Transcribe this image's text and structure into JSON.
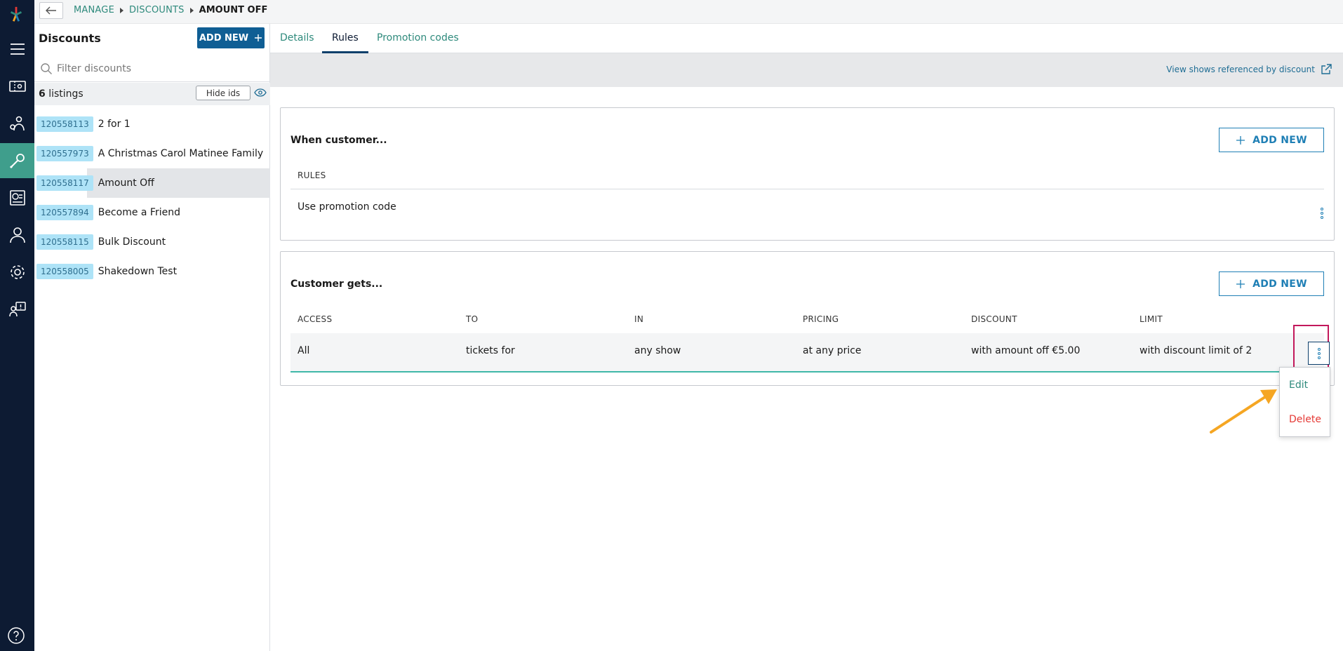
{
  "colors": {
    "rail_bg": "#0d1b33",
    "active_nav": "#3f9e8c",
    "link_teal": "#2e8a7c",
    "primary_blue": "#0f5e94",
    "badge_bg": "#aee3f7",
    "delete_red": "#e53935",
    "highlight_magenta": "#c2185b",
    "arrow_orange": "#f5a623"
  },
  "rail": {
    "icons": [
      "logo",
      "menu-icon",
      "ticket-icon",
      "users-icon",
      "tools-icon",
      "reports-icon",
      "person-icon",
      "gear-icon",
      "support-icon",
      "help-icon"
    ],
    "active": "tools-icon"
  },
  "breadcrumb": {
    "items": [
      "MANAGE",
      "DISCOUNTS"
    ],
    "current": "AMOUNT OFF"
  },
  "sidebar": {
    "title": "Discounts",
    "add_new_label": "ADD NEW",
    "filter_placeholder": "Filter discounts",
    "listing_count": "6",
    "listing_suffix": "listings",
    "hide_ids_label": "Hide ids",
    "items": [
      {
        "id": "120558113",
        "label": "2 for 1"
      },
      {
        "id": "120557973",
        "label": "A Christmas Carol Matinee Family"
      },
      {
        "id": "120558117",
        "label": "Amount Off"
      },
      {
        "id": "120557894",
        "label": "Become a Friend"
      },
      {
        "id": "120558115",
        "label": "Bulk Discount"
      },
      {
        "id": "120558005",
        "label": "Shakedown Test"
      }
    ],
    "selected_index": 2
  },
  "tabs": [
    {
      "label": "Details"
    },
    {
      "label": "Rules"
    },
    {
      "label": "Promotion codes"
    }
  ],
  "active_tab": "Rules",
  "ref_link_label": "View shows referenced by discount",
  "when_card": {
    "title": "When customer...",
    "add_new_label": "ADD NEW",
    "column": "RULES",
    "rule": "Use promotion code"
  },
  "gets_card": {
    "title": "Customer gets...",
    "add_new_label": "ADD NEW",
    "columns": [
      "ACCESS",
      "TO",
      "IN",
      "PRICING",
      "DISCOUNT",
      "LIMIT"
    ],
    "row": [
      "All",
      "tickets for",
      "any show",
      "at any price",
      "with amount off €5.00",
      "with discount limit of 2"
    ]
  },
  "context_menu": {
    "edit_label": "Edit",
    "delete_label": "Delete"
  }
}
